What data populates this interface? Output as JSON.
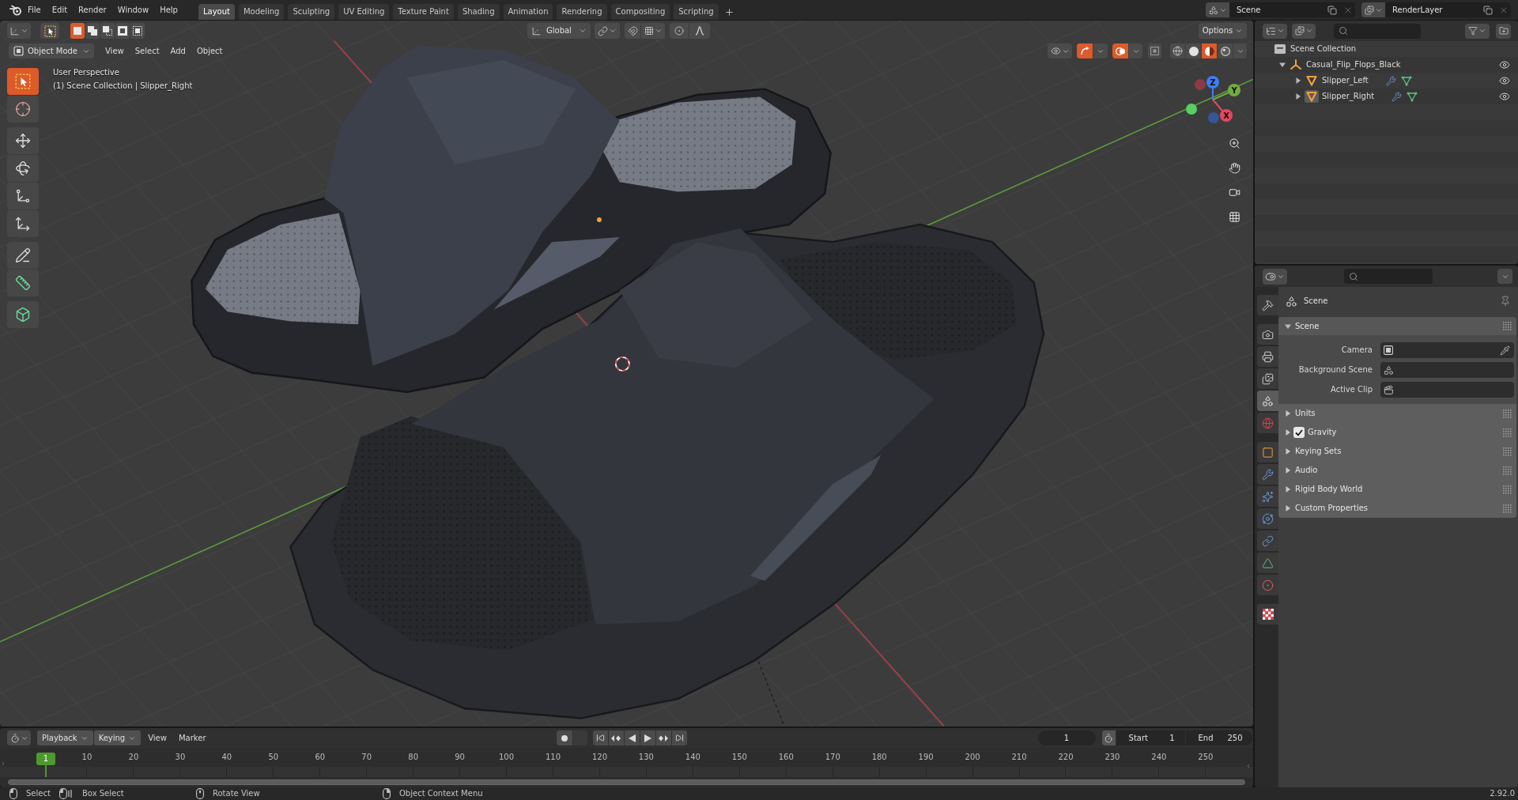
{
  "top_bar": {
    "menus": [
      "File",
      "Edit",
      "Render",
      "Window",
      "Help"
    ],
    "workspaces": [
      {
        "label": "Layout",
        "selected": true
      },
      {
        "label": "Modeling",
        "selected": false
      },
      {
        "label": "Sculpting",
        "selected": false
      },
      {
        "label": "UV Editing",
        "selected": false
      },
      {
        "label": "Texture Paint",
        "selected": false
      },
      {
        "label": "Shading",
        "selected": false
      },
      {
        "label": "Animation",
        "selected": false
      },
      {
        "label": "Rendering",
        "selected": false
      },
      {
        "label": "Compositing",
        "selected": false
      },
      {
        "label": "Scripting",
        "selected": false
      }
    ],
    "scene": "Scene",
    "view_layer": "RenderLayer"
  },
  "viewport": {
    "header": {
      "select_modes": [
        {
          "kind": "set",
          "selected": true
        },
        {
          "kind": "extend",
          "selected": false
        },
        {
          "kind": "subtract",
          "selected": false
        },
        {
          "kind": "difference",
          "selected": false
        },
        {
          "kind": "intersect",
          "selected": false
        }
      ],
      "transform_orientation": "Global",
      "options": "Options",
      "mode": "Object Mode",
      "menus": [
        "View",
        "Select",
        "Add",
        "Object"
      ],
      "gizmos": true,
      "overlays": true,
      "xray": false,
      "shading_modes": [
        {
          "kind": "wireframe",
          "selected": false
        },
        {
          "kind": "solid",
          "selected": false
        },
        {
          "kind": "material",
          "selected": true
        },
        {
          "kind": "rendered",
          "selected": false
        }
      ]
    },
    "tool_groups": [
      [
        {
          "kind": "select_box",
          "selected": true
        },
        {
          "kind": "cursor",
          "selected": false
        }
      ],
      [
        {
          "kind": "move",
          "selected": false
        },
        {
          "kind": "rotate",
          "selected": false
        },
        {
          "kind": "scale",
          "selected": false
        },
        {
          "kind": "transform",
          "selected": false
        }
      ],
      [
        {
          "kind": "annotate",
          "selected": false
        },
        {
          "kind": "measure",
          "selected": false
        }
      ],
      [
        {
          "kind": "add_cube",
          "selected": false
        }
      ]
    ],
    "info": [
      "User Perspective",
      "(1) Scene Collection | Slipper_Right"
    ],
    "gizmo_axes": [
      {
        "kind": "z",
        "label": "Z"
      },
      {
        "kind": "y",
        "label": "Y"
      },
      {
        "kind": "x",
        "label": "X"
      }
    ]
  },
  "outliner": {
    "tree": [
      {
        "name": "Scene Collection",
        "kind": "collection",
        "selected": false,
        "children": [
          {
            "name": "Casual_Flip_Flops_Black",
            "kind": "empty",
            "expanded": true,
            "selected": false,
            "visible": true,
            "children": [
              {
                "name": "Slipper_Left",
                "kind": "mesh",
                "expanded": false,
                "selected": false,
                "modifiers": true,
                "visible": true
              },
              {
                "name": "Slipper_Right",
                "kind": "mesh",
                "expanded": false,
                "selected": true,
                "modifiers": true,
                "visible": true
              }
            ]
          }
        ]
      }
    ]
  },
  "properties": {
    "tab_groups": [
      [
        {
          "kind": "tool",
          "selected": false
        }
      ],
      [
        {
          "kind": "render",
          "selected": false
        },
        {
          "kind": "output",
          "selected": false
        },
        {
          "kind": "view_layer",
          "selected": false
        },
        {
          "kind": "scene",
          "selected": true
        },
        {
          "kind": "world",
          "selected": false
        }
      ],
      [
        {
          "kind": "object",
          "selected": false
        },
        {
          "kind": "modifiers",
          "selected": false
        },
        {
          "kind": "particles",
          "selected": false
        },
        {
          "kind": "physics",
          "selected": false
        },
        {
          "kind": "constraints",
          "selected": false
        },
        {
          "kind": "data",
          "selected": false
        },
        {
          "kind": "material",
          "selected": false
        }
      ],
      [
        {
          "kind": "texture",
          "selected": false
        }
      ]
    ],
    "context": "Scene",
    "panel": {
      "title": "Scene",
      "expanded": true,
      "fields": [
        {
          "kind": "camera",
          "label": "Camera"
        },
        {
          "kind": "scene",
          "label": "Background Scene"
        },
        {
          "kind": "clip",
          "label": "Active Clip"
        }
      ],
      "subpanels": [
        {
          "title": "Units",
          "expanded": false
        },
        {
          "title": "Gravity",
          "expanded": false,
          "checked": true
        },
        {
          "title": "Keying Sets",
          "expanded": false
        },
        {
          "title": "Audio",
          "expanded": false
        },
        {
          "title": "Rigid Body World",
          "expanded": false
        },
        {
          "title": "Custom Properties",
          "expanded": false
        }
      ]
    }
  },
  "timeline": {
    "menus": [
      {
        "kind": "dropdown",
        "label": "Playback"
      },
      {
        "kind": "dropdown",
        "label": "Keying"
      },
      {
        "kind": "menu",
        "label": "View"
      },
      {
        "kind": "menu",
        "label": "Marker"
      }
    ],
    "auto_keying": false,
    "current_frame": "1",
    "start_label": "Start",
    "start": "1",
    "end_label": "End",
    "end": "250",
    "playhead": "1",
    "ruler": [
      "10",
      "20",
      "30",
      "40",
      "50",
      "60",
      "70",
      "80",
      "90",
      "100",
      "110",
      "120",
      "130",
      "140",
      "150",
      "160",
      "170",
      "180",
      "190",
      "200",
      "210",
      "220",
      "230",
      "240",
      "250"
    ]
  },
  "status_bar": {
    "hints": [
      {
        "kind": "left_click",
        "label": "Select"
      },
      {
        "kind": "left_drag",
        "label": "Box Select"
      },
      {
        "kind": "middle_click",
        "label": "Rotate View"
      },
      {
        "kind": "right_click",
        "label": "Object Context Menu"
      }
    ],
    "version": "2.92.0"
  }
}
